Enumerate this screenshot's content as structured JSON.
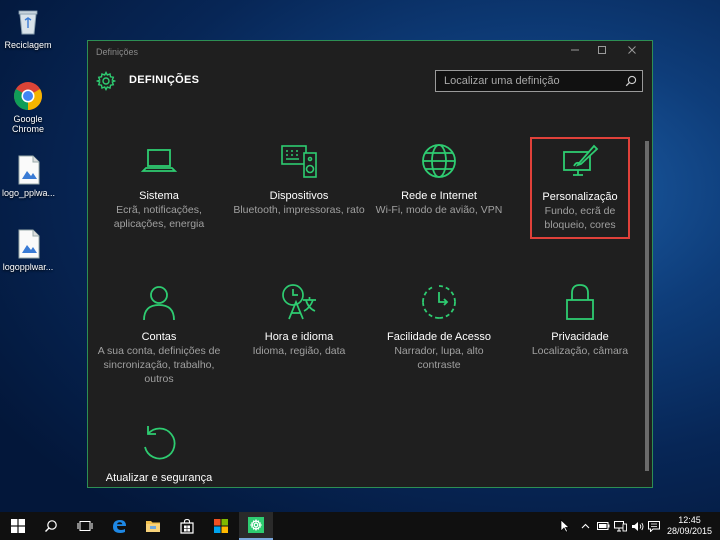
{
  "desktop": {
    "icons": [
      {
        "label": "Reciclagem",
        "icon": "recycle-bin-icon"
      },
      {
        "label": "Google Chrome",
        "icon": "chrome-icon"
      },
      {
        "label": "logo_pplwa...",
        "icon": "image-file-icon"
      },
      {
        "label": "logopplwar...",
        "icon": "image-file-icon"
      }
    ]
  },
  "window": {
    "title": "Definições",
    "header_title": "DEFINIÇÕES",
    "search_placeholder": "Localizar uma definição",
    "accent_color": "#2ecc71",
    "selected_border_color": "#e0413a"
  },
  "tiles": [
    {
      "name": "Sistema",
      "desc": "Ecrã, notificações, aplicações, energia",
      "icon": "laptop-icon",
      "selected": false
    },
    {
      "name": "Dispositivos",
      "desc": "Bluetooth, impressoras, rato",
      "icon": "devices-icon",
      "selected": false
    },
    {
      "name": "Rede e Internet",
      "desc": "Wi-Fi, modo de avião, VPN",
      "icon": "globe-icon",
      "selected": false
    },
    {
      "name": "Personalização",
      "desc": "Fundo, ecrã de bloqueio, cores",
      "icon": "paintbrush-icon",
      "selected": true
    },
    {
      "name": "Contas",
      "desc": "A sua conta, definições de sincronização, trabalho, outros",
      "icon": "person-icon",
      "selected": false
    },
    {
      "name": "Hora e idioma",
      "desc": "Idioma, região, data",
      "icon": "time-language-icon",
      "selected": false
    },
    {
      "name": "Facilidade de Acesso",
      "desc": "Narrador, lupa, alto contraste",
      "icon": "ease-of-access-icon",
      "selected": false
    },
    {
      "name": "Privacidade",
      "desc": "Localização, câmara",
      "icon": "lock-icon",
      "selected": false
    },
    {
      "name": "Atualizar e segurança",
      "desc": "",
      "icon": "refresh-icon",
      "selected": false
    }
  ],
  "taskbar": {
    "time": "12:45",
    "date": "28/09/2015"
  }
}
